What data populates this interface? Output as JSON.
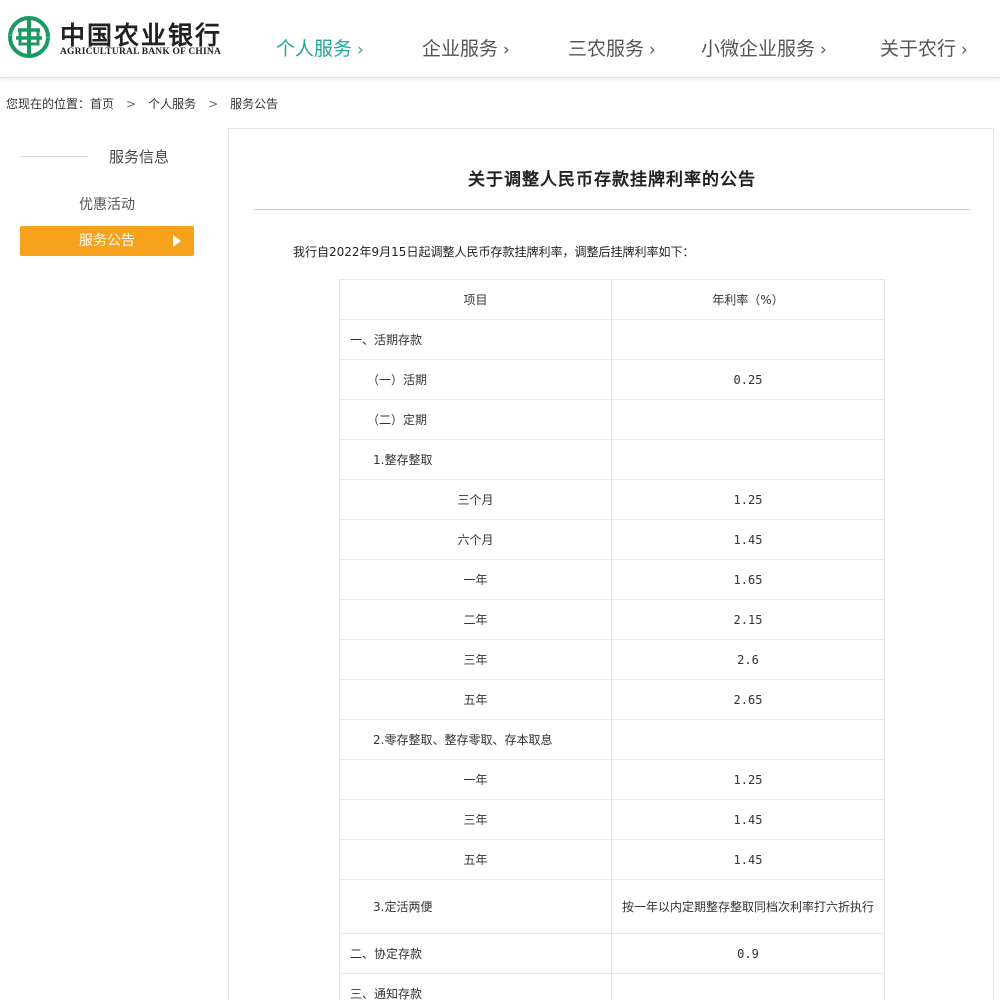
{
  "header": {
    "logo_cn": "中国农业银行",
    "logo_en": "AGRICULTURAL BANK OF CHINA",
    "brand_color": "#1a9a63",
    "nav": [
      {
        "label": "个人服务",
        "active": true
      },
      {
        "label": "企业服务",
        "active": false
      },
      {
        "label": "三农服务",
        "active": false
      },
      {
        "label": "小微企业服务",
        "active": false
      },
      {
        "label": "关于农行",
        "active": false
      }
    ],
    "nav_chevron": "›",
    "active_color": "#22a89a"
  },
  "breadcrumb": {
    "prefix": "您现在的位置：",
    "items": [
      "首页",
      "个人服务",
      "服务公告"
    ],
    "separator": ">"
  },
  "sidebar": {
    "heading": "服务信息",
    "items": [
      {
        "label": "优惠活动",
        "active": false
      },
      {
        "label": "服务公告",
        "active": true
      }
    ],
    "accent_color": "#f6a21d"
  },
  "article": {
    "title": "关于调整人民币存款挂牌利率的公告",
    "intro": "我行自2022年9月15日起调整人民币存款挂牌利率，调整后挂牌利率如下：",
    "table": {
      "headers": [
        "项目",
        "年利率（%）"
      ],
      "rows": [
        {
          "name": "一、活期存款",
          "value": "",
          "indent": 0
        },
        {
          "name": "（一）活期",
          "value": "0.25",
          "indent": 1
        },
        {
          "name": "（二）定期",
          "value": "",
          "indent": 1
        },
        {
          "name": "1.整存整取",
          "value": "",
          "indent": 2
        },
        {
          "name": "三个月",
          "value": "1.25",
          "indent": 3
        },
        {
          "name": "六个月",
          "value": "1.45",
          "indent": 3
        },
        {
          "name": "一年",
          "value": "1.65",
          "indent": 3
        },
        {
          "name": "二年",
          "value": "2.15",
          "indent": 3
        },
        {
          "name": "三年",
          "value": "2.6",
          "indent": 3
        },
        {
          "name": "五年",
          "value": "2.65",
          "indent": 3
        },
        {
          "name": "2.零存整取、整存零取、存本取息",
          "value": "",
          "indent": 2
        },
        {
          "name": "一年",
          "value": "1.25",
          "indent": 3
        },
        {
          "name": "三年",
          "value": "1.45",
          "indent": 3
        },
        {
          "name": "五年",
          "value": "1.45",
          "indent": 3
        },
        {
          "name": "3.定活两便",
          "value": "按一年以内定期整存整取同档次利率打六折执行",
          "indent": 2,
          "note": true
        },
        {
          "name": "二、协定存款",
          "value": "0.9",
          "indent": 0
        },
        {
          "name": "三、通知存款",
          "value": "",
          "indent": 0
        }
      ]
    }
  }
}
